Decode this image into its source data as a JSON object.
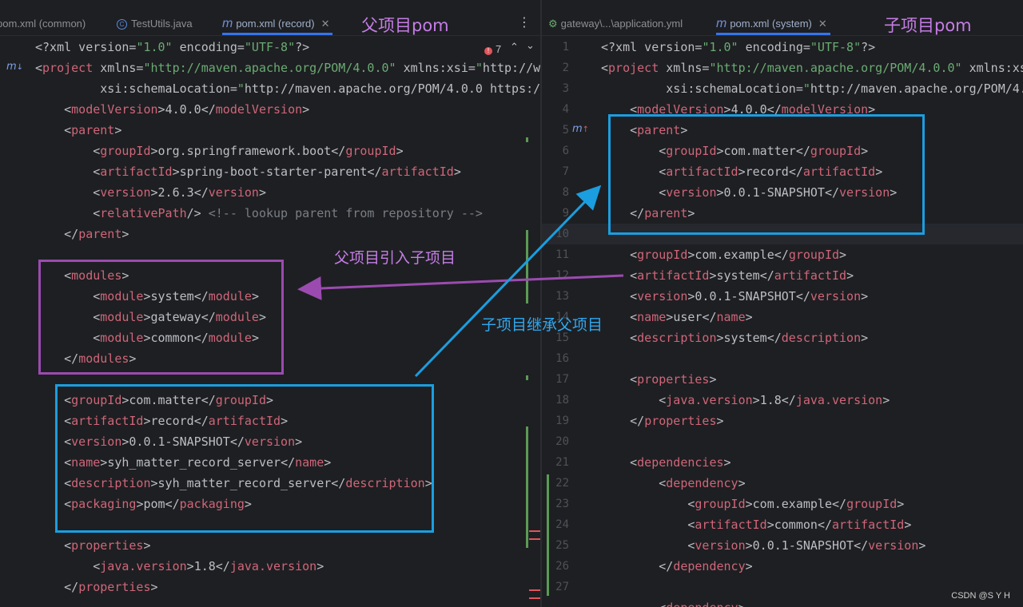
{
  "left_tabs": [
    {
      "label": "pom.xml (common)",
      "icon": "maven-file-icon",
      "active": false
    },
    {
      "label": "TestUtils.java",
      "icon": "java-class-icon",
      "active": false
    },
    {
      "label": "pom.xml (record)",
      "icon": "maven-file-icon",
      "active": true
    }
  ],
  "right_tabs": [
    {
      "label": "gateway\\...\\application.yml",
      "icon": "spring-config-icon",
      "active": false
    },
    {
      "label": "pom.xml (system)",
      "icon": "maven-file-icon",
      "active": true
    }
  ],
  "left_pane_label": "父项目pom",
  "right_pane_label": "子项目pom",
  "error_count": "7",
  "annotations": {
    "parent_includes_children": "父项目引入子项目",
    "child_inherits_parent": "子项目继承父项目"
  },
  "colors": {
    "purple_box": "#9b4bb0",
    "blue_box": "#1a9ee0",
    "purple_text": "#c57de6",
    "blue_text": "#2fa8f0",
    "tag": "#cf6679",
    "string": "#6aab73",
    "comment": "#7a7e85"
  },
  "left_code": [
    {
      "num": "",
      "text": "<?xml version=\"1.0\" encoding=\"UTF-8\"?>"
    },
    {
      "num": "",
      "text": "<project xmlns=\"http://maven.apache.org/POM/4.0.0\" xmlns:xsi=\"http://w"
    },
    {
      "num": "",
      "text": "         xsi:schemaLocation=\"http://maven.apache.org/POM/4.0.0 https:/"
    },
    {
      "num": "",
      "text": "    <modelVersion>4.0.0</modelVersion>"
    },
    {
      "num": "",
      "text": "    <parent>"
    },
    {
      "num": "",
      "text": "        <groupId>org.springframework.boot</groupId>"
    },
    {
      "num": "",
      "text": "        <artifactId>spring-boot-starter-parent</artifactId>"
    },
    {
      "num": "",
      "text": "        <version>2.6.3</version>"
    },
    {
      "num": "",
      "text": "        <relativePath/> <!-- lookup parent from repository -->"
    },
    {
      "num": "",
      "text": "    </parent>"
    },
    {
      "num": "",
      "text": ""
    },
    {
      "num": "",
      "text": "    <modules>"
    },
    {
      "num": "",
      "text": "        <module>system</module>"
    },
    {
      "num": "",
      "text": "        <module>gateway</module>"
    },
    {
      "num": "",
      "text": "        <module>common</module>"
    },
    {
      "num": "",
      "text": "    </modules>"
    },
    {
      "num": "",
      "text": ""
    },
    {
      "num": "",
      "text": "    <groupId>com.matter</groupId>"
    },
    {
      "num": "",
      "text": "    <artifactId>record</artifactId>"
    },
    {
      "num": "",
      "text": "    <version>0.0.1-SNAPSHOT</version>"
    },
    {
      "num": "",
      "text": "    <name>syh_matter_record_server</name>"
    },
    {
      "num": "",
      "text": "    <description>syh_matter_record_server</description>"
    },
    {
      "num": "",
      "text": "    <packaging>pom</packaging>"
    },
    {
      "num": "",
      "text": ""
    },
    {
      "num": "",
      "text": "    <properties>"
    },
    {
      "num": "",
      "text": "        <java.version>1.8</java.version>"
    },
    {
      "num": "",
      "text": "    </properties>"
    }
  ],
  "right_code": [
    {
      "num": "1",
      "text": "<?xml version=\"1.0\" encoding=\"UTF-8\"?>"
    },
    {
      "num": "2",
      "text": "<project xmlns=\"http://maven.apache.org/POM/4.0.0\" xmlns:xsi"
    },
    {
      "num": "3",
      "text": "         xsi:schemaLocation=\"http://maven.apache.org/POM/4."
    },
    {
      "num": "4",
      "text": "    <modelVersion>4.0.0</modelVersion>"
    },
    {
      "num": "5",
      "text": "    <parent>"
    },
    {
      "num": "6",
      "text": "        <groupId>com.matter</groupId>"
    },
    {
      "num": "7",
      "text": "        <artifactId>record</artifactId>"
    },
    {
      "num": "8",
      "text": "        <version>0.0.1-SNAPSHOT</version>"
    },
    {
      "num": "9",
      "text": "    </parent>"
    },
    {
      "num": "10",
      "text": ""
    },
    {
      "num": "11",
      "text": "    <groupId>com.example</groupId>"
    },
    {
      "num": "12",
      "text": "    <artifactId>system</artifactId>"
    },
    {
      "num": "13",
      "text": "    <version>0.0.1-SNAPSHOT</version>"
    },
    {
      "num": "14",
      "text": "    <name>user</name>"
    },
    {
      "num": "15",
      "text": "    <description>system</description>"
    },
    {
      "num": "16",
      "text": ""
    },
    {
      "num": "17",
      "text": "    <properties>"
    },
    {
      "num": "18",
      "text": "        <java.version>1.8</java.version>"
    },
    {
      "num": "19",
      "text": "    </properties>"
    },
    {
      "num": "20",
      "text": ""
    },
    {
      "num": "21",
      "text": "    <dependencies>"
    },
    {
      "num": "22",
      "text": "        <dependency>"
    },
    {
      "num": "23",
      "text": "            <groupId>com.example</groupId>"
    },
    {
      "num": "24",
      "text": "            <artifactId>common</artifactId>"
    },
    {
      "num": "25",
      "text": "            <version>0.0.1-SNAPSHOT</version>"
    },
    {
      "num": "26",
      "text": "        </dependency>"
    },
    {
      "num": "27",
      "text": ""
    },
    {
      "num": "",
      "text": "        <dependency>"
    }
  ],
  "watermark": "CSDN @S Y H"
}
